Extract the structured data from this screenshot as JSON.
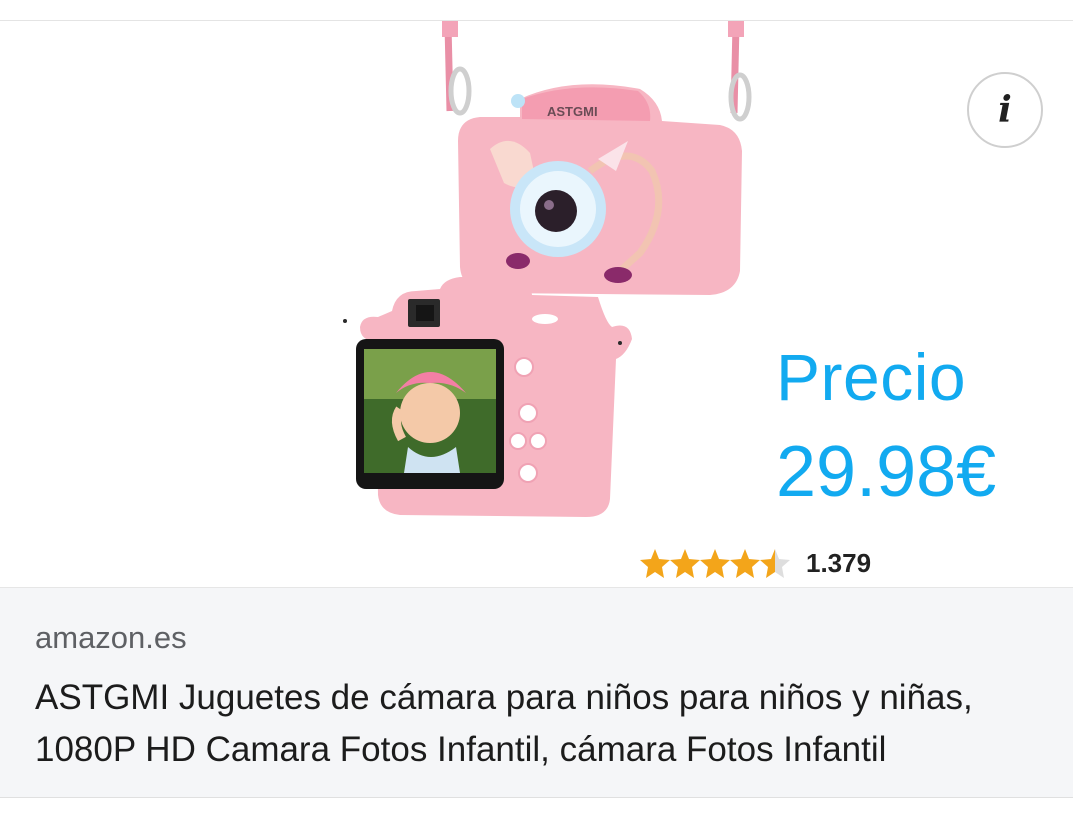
{
  "ad": {
    "info_icon": "info-icon",
    "info_glyph": "i",
    "image": {
      "camera_brand": "ASTGMI",
      "price_label": "Precio",
      "price_value": "29.98€",
      "rating_count": "1.379",
      "rating_stars": 4.5,
      "colors": {
        "price": "#12aaf0",
        "star": "#f3a51a",
        "camera_pink": "#f7b6c3"
      }
    },
    "source": "amazon.es",
    "title": "ASTGMI Juguetes de cámara para niños para niños y niñas, 1080P HD Camara Fotos Infantil, cámara Fotos Infantil"
  }
}
